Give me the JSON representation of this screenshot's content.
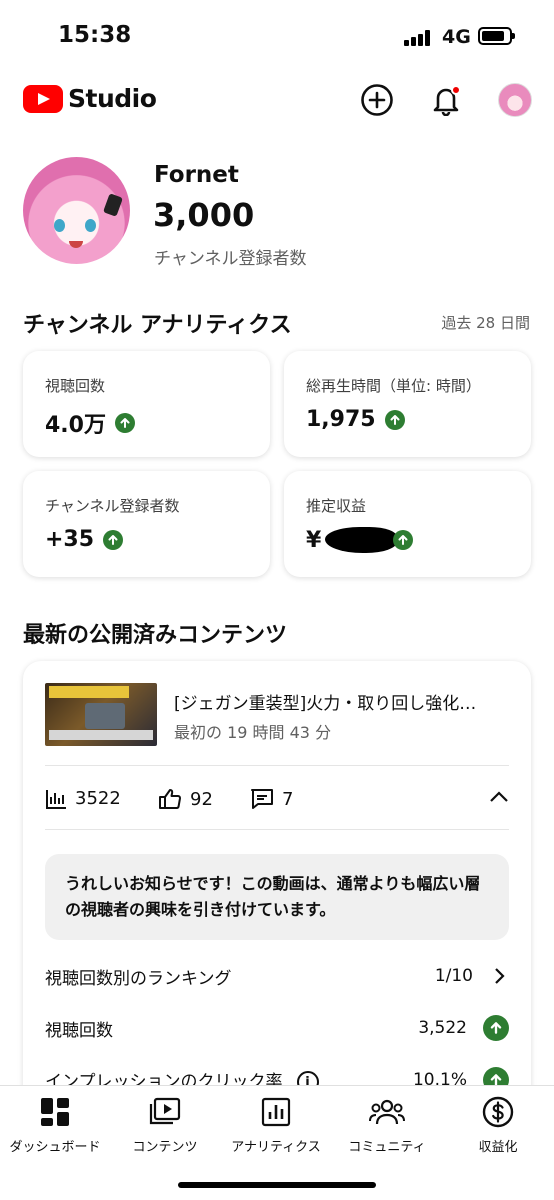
{
  "status_bar": {
    "time": "15:38",
    "network": "4G"
  },
  "header": {
    "logo_text": "Studio"
  },
  "channel": {
    "name": "Fornet",
    "subscribers": "3,000",
    "subscribers_label": "チャンネル登録者数"
  },
  "analytics": {
    "title": "チャンネル アナリティクス",
    "period": "過去 28 日間",
    "cards": [
      {
        "label": "視聴回数",
        "value": "4.0万"
      },
      {
        "label": "総再生時間（単位: 時間）",
        "value": "1,975"
      },
      {
        "label": "チャンネル登録者数",
        "value": "+35"
      },
      {
        "label": "推定収益",
        "value": "¥"
      }
    ]
  },
  "latest": {
    "title": "最新の公開済みコンテンツ",
    "video_title": "[ジェガン重装型]火力・取り回し強化…",
    "video_time": "最初の 19 時間 43 分",
    "views": "3522",
    "likes": "92",
    "comments": "7",
    "notice": "うれしいお知らせです！この動画は、通常よりも幅広い層の視聴者の興味を引き付けています。",
    "rows": [
      {
        "label": "視聴回数別のランキング",
        "value": "1/10"
      },
      {
        "label": "視聴回数",
        "value": "3,522"
      },
      {
        "label": "インプレッションのクリック率",
        "value": "10.1%"
      }
    ]
  },
  "nav": [
    "ダッシュボード",
    "コンテンツ",
    "アナリティクス",
    "コミュニティ",
    "収益化"
  ],
  "colors": {
    "brand_red": "#ff0000",
    "up_green": "#2e7d32",
    "notification_red": "#e00000"
  }
}
